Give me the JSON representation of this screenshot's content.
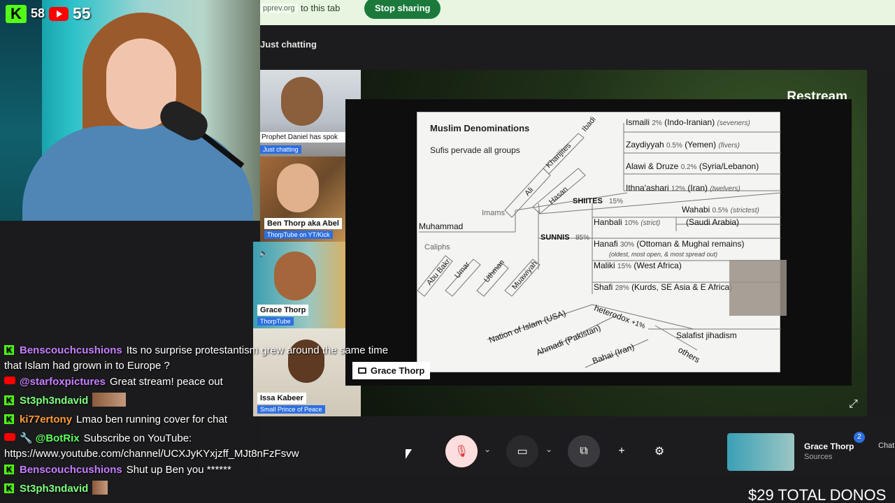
{
  "share_bar": {
    "url": "pprev.org",
    "tab_text": "to this tab",
    "stop_label": "Stop sharing"
  },
  "subbar": {
    "title": "Just chatting"
  },
  "badges": {
    "kick_count": "58",
    "youtube_count": "55"
  },
  "participants": [
    {
      "name": "Prophet Daniel has spok",
      "sub": "Just chatting"
    },
    {
      "name": "Ben Thorp aka Abel",
      "sub": "ThorpTube on YT/Kick"
    },
    {
      "name": "Grace Thorp",
      "sub": "ThorpTube"
    },
    {
      "name": "Issa Kabeer",
      "sub": "Small Prince of Peace"
    }
  ],
  "stage": {
    "brand": "Restream",
    "owner": "Grace Thorp"
  },
  "slide": {
    "title": "Muslim Denominations",
    "note": "Sufis pervade all groups",
    "root": "Muhammad",
    "labels": {
      "ibadi": "Ibadi",
      "kharijites": "Kharijites",
      "ali": "Ali",
      "hasan": "Hasan",
      "imams": "Imams",
      "caliphs": "Caliphs",
      "abu_bakr": "Abu Bakr",
      "umar": "Umar",
      "uthman": "Uthman",
      "muawiyah": "Muawiyah",
      "shiites": "SHIITES",
      "shiites_pct": "15%",
      "sunnis": "SUNNIS",
      "sunnis_pct": "85%",
      "ismaili": "Ismaili",
      "ismaili_pct": "2%",
      "ismaili_where": "(Indo-Iranian)",
      "ismaili_note": "(seveners)",
      "zaydiyyah": "Zaydiyyah",
      "zaydiyyah_pct": "0.5%",
      "zaydiyyah_where": "(Yemen)",
      "zaydiyyah_note": "(fivers)",
      "alawi": "Alawi & Druze",
      "alawi_pct": "0.2%",
      "alawi_where": "(Syria/Lebanon)",
      "ithna": "Ithna'ashari",
      "ithna_pct": "12%",
      "ithna_where": "(Iran)",
      "ithna_note": "(twelvers)",
      "wahabi": "Wahabi",
      "wahabi_pct": "0.5%",
      "wahabi_note": "(strictest)",
      "wahabi_where": "(Saudi Arabia)",
      "hanbali": "Hanbali",
      "hanbali_pct": "10%",
      "hanbali_note": "(strict)",
      "hanafi": "Hanafi",
      "hanafi_pct": "30%",
      "hanafi_where": "(Ottoman & Mughal remains)",
      "hanafi_note": "(oldest, most open, & most spread out)",
      "maliki": "Maliki",
      "maliki_pct": "15%",
      "maliki_where": "(West Africa)",
      "shafi": "Shafi",
      "shafi_pct": "28%",
      "shafi_where": "(Kurds, SE Asia & E Africa)",
      "heterodox": "heterodox",
      "heterodox_pct": "+1%",
      "noi": "Nation of Islam (USA)",
      "ahmadi": "Ahmadi (Pakistan)",
      "bahai": "Bahai (Iran)",
      "salafist": "Salafist jihadism",
      "others": "others"
    }
  },
  "toolbar": {
    "self_name": "Grace Thorp",
    "self_sub": "Sources",
    "notif_count": "2",
    "chat_label": "Chat"
  },
  "chat": [
    {
      "platform": "kick",
      "user": "Benscouchcushions",
      "color": "#c77dff",
      "text": "Its no surprise protestantism grew around the same time",
      "cont": "that Islam had grown in to Europe ?"
    },
    {
      "platform": "youtube",
      "user": "@starfoxpictures",
      "color": "#c77dff",
      "text": "Great stream! peace out"
    },
    {
      "platform": "kick",
      "user": "St3ph3ndavid",
      "color": "#7bff7b",
      "text": "",
      "emote": true
    },
    {
      "platform": "kick",
      "user": "ki77ertony",
      "color": "#ff9b3d",
      "text": "Lmao ben running cover for chat"
    },
    {
      "platform": "youtube",
      "user": "@BotRix",
      "color": "#5cff5c",
      "text": "Subscribe on YouTube:",
      "cont": "https://www.youtube.com/channel/UCXJyKYxjzff_MJt8nFzFsvw"
    },
    {
      "platform": "kick",
      "user": "Benscouchcushions",
      "color": "#c77dff",
      "text": "Shut up Ben you ******"
    },
    {
      "platform": "kick",
      "user": "St3ph3ndavid",
      "color": "#7bff7b",
      "text": "",
      "emote_small": true
    }
  ],
  "donos": "$29 TOTAL DONOS"
}
